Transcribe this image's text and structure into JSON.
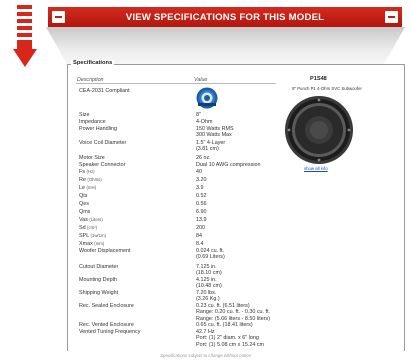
{
  "banner": {
    "title": "VIEW SPECIFICATIONS FOR THIS MODEL"
  },
  "specs": {
    "legend": "Specifications",
    "col_description": "Description",
    "col_value": "Value",
    "model": "P1S48",
    "image_caption": "8\" Punch P1 4-Ohm SVC Subwoofer",
    "show_all": "show all info",
    "rows": [
      {
        "label": "CEA-2031 Compliant",
        "label_unit": "",
        "value": ""
      },
      {
        "label": "Size",
        "label_unit": "",
        "value": "8\""
      },
      {
        "label": "Impedance",
        "label_unit": "",
        "value": "4-Ohm"
      },
      {
        "label": "Power Handling",
        "label_unit": "",
        "value": "150 Watts RMS\n300 Watts Max"
      },
      {
        "label": "Voice Coil Diameter",
        "label_unit": "",
        "value": "1.5\" 4-Layer\n(3.81 cm)"
      },
      {
        "label": "Motor Size",
        "label_unit": "",
        "value": "26 oz."
      },
      {
        "label": "Speaker Connector",
        "label_unit": "",
        "value": "Dual 10 AWG compression"
      },
      {
        "label": "Fs",
        "label_unit": "(Hz)",
        "value": "40"
      },
      {
        "label": "Re",
        "label_unit": "(Ohms)",
        "value": "3.20"
      },
      {
        "label": "Le",
        "label_unit": "(mH)",
        "value": "3.9"
      },
      {
        "label": "Qts",
        "label_unit": "",
        "value": "0.52"
      },
      {
        "label": "Qes",
        "label_unit": "",
        "value": "0.56"
      },
      {
        "label": "Qms",
        "label_unit": "",
        "value": "6.90"
      },
      {
        "label": "Vas",
        "label_unit": "(Liters)",
        "value": "13.9"
      },
      {
        "label": "Sd",
        "label_unit": "(cm²)",
        "value": "200"
      },
      {
        "label": "SPL",
        "label_unit": "(1w/1m)",
        "value": "84"
      },
      {
        "label": "Xmax",
        "label_unit": "(mm)",
        "value": "8.4"
      },
      {
        "label": "Woofer Displacement",
        "label_unit": "",
        "value": "0.024 cu. ft.\n(0.69 Liters)"
      },
      {
        "label": "Cutout Diameter",
        "label_unit": "",
        "value": "7.125 in.\n(18.10 cm)"
      },
      {
        "label": "Mounting Depth",
        "label_unit": "",
        "value": "4.125 in.\n(10.48 cm)"
      },
      {
        "label": "Shipping Weight",
        "label_unit": "",
        "value": "7.20 lbs.\n(3.26 Kg.)"
      },
      {
        "label": "Rec. Sealed Enclosure",
        "label_unit": "",
        "value": "0.23 cu. ft. (6.51 liters)\nRange: 0.20 cu. ft. - 0.30 cu. ft.\nRange: (5.66 liters - 8.50 liters)"
      },
      {
        "label": "Rec. Vented Enclosure",
        "label_unit": "",
        "value": "0.65 cu. ft. (18.41 liters)"
      },
      {
        "label": "Vented Tuning Frequency",
        "label_unit": "",
        "value": "42.7 Hz\nPort: (1) 2\" diam. x 6\" long\nPort: (1) 5.08 cm x 15.24 cm"
      }
    ],
    "footnote": "Specifications subject to change without notice"
  }
}
